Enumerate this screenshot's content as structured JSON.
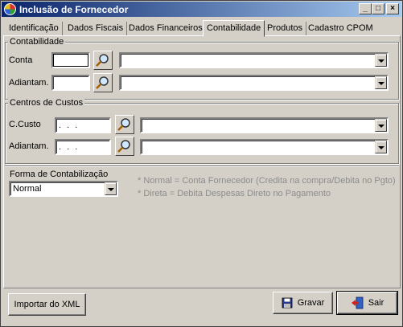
{
  "window": {
    "title": "Inclusão de Fornecedor"
  },
  "titlebar_buttons": {
    "minimize": "_",
    "maximize": "□",
    "close": "×"
  },
  "tabs": [
    {
      "label": "Identificação"
    },
    {
      "label": "Dados Fiscais"
    },
    {
      "label": "Dados Financeiros"
    },
    {
      "label": "Contabilidade",
      "active": true
    },
    {
      "label": "Produtos"
    },
    {
      "label": "Cadastro CPOM"
    }
  ],
  "contabilidade": {
    "group_label": "Contabilidade",
    "conta_label": "Conta",
    "conta_value": "",
    "conta_combo": "",
    "adiantam_label": "Adiantam.",
    "adiantam_value": "",
    "adiantam_combo": ""
  },
  "centros": {
    "group_label": "Centros de Custos",
    "ccusto_label": "C.Custo",
    "ccusto_value": ". . .",
    "ccusto_combo": "",
    "adiantam_label": "Adiantam.",
    "adiantam_value": ". . .",
    "adiantam_combo": ""
  },
  "forma": {
    "label": "Forma de Contabilização",
    "selected": "Normal",
    "note_normal": "* Normal = Conta Fornecedor (Credita na compra/Debita no Pgto)",
    "note_direta": "* Direta = Debita Despesas Direto no Pagamento"
  },
  "footer": {
    "import_label": "Importar do XML",
    "save_label": "Gravar",
    "exit_label": "Sair"
  },
  "icons": {
    "search": "magnifier-icon",
    "save": "floppy-disk-icon",
    "exit": "exit-door-icon",
    "app": "app-logo-icon"
  }
}
